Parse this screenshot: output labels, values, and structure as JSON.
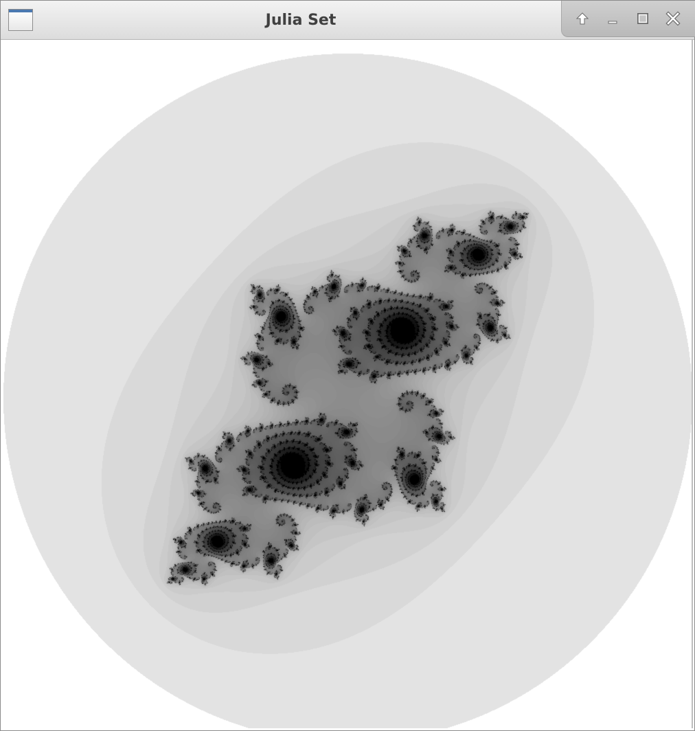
{
  "window": {
    "title": "Julia Set",
    "icons": {
      "app": "window-app-icon",
      "shade": "arrow-up-icon",
      "minimize": "minimize-icon",
      "maximize": "maximize-icon",
      "close": "close-icon"
    }
  },
  "colors": {
    "fractal": "#000000",
    "background": "#ffffff",
    "titlebar": "#e0e0e0",
    "title_text": "#404040"
  }
}
